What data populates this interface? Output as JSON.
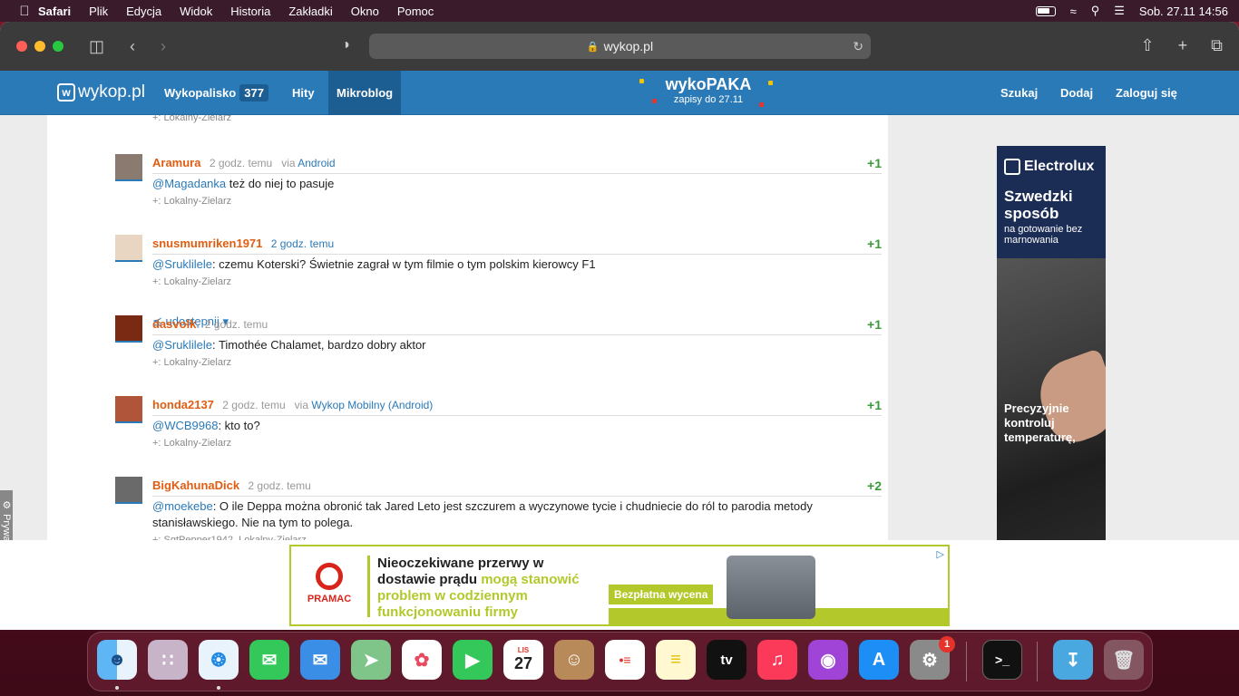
{
  "menubar": {
    "app": "Safari",
    "items": [
      "Plik",
      "Edycja",
      "Widok",
      "Historia",
      "Zakładki",
      "Okno",
      "Pomoc"
    ],
    "datetime": "Sob. 27.11  14:56"
  },
  "browser": {
    "url": "wykop.pl"
  },
  "nav": {
    "logo": "wykop.pl",
    "wykopalisko": "Wykopalisko",
    "wykopalisko_count": "377",
    "hity": "Hity",
    "mikroblog": "Mikroblog",
    "promo_title": "wykoPAKA",
    "promo_sub": "zapisy do 27.11",
    "szukaj": "Szukaj",
    "dodaj": "Dodaj",
    "zaloguj": "Zaloguj się"
  },
  "top_tags": "Lokalny-Zielarz",
  "posts": [
    {
      "author": "Aramura",
      "time": "2 godz. temu",
      "via_prefix": "via",
      "via": "Android",
      "vote": "+1",
      "mention": "@Magadanka",
      "text": " też do niej to pasuje",
      "tags": "Lokalny-Zielarz"
    },
    {
      "author": "snusmumriken1971",
      "time": "2 godz. temu",
      "via_prefix": "",
      "via": "",
      "vote": "+1",
      "mention": "@Sruklilele",
      "text": ": czemu Koterski? Świetnie zagrał w tym filmie o tym polskim kierowcy F1",
      "tags": "Lokalny-Zielarz"
    },
    {
      "author": "dasvolk",
      "time": "2 godz. temu",
      "via_prefix": "",
      "via": "",
      "vote": "+1",
      "mention": "@Sruklilele",
      "text": ": Timothée Chalamet, bardzo dobry aktor",
      "tags": "Lokalny-Zielarz"
    },
    {
      "author": "honda2137",
      "time": "2 godz. temu",
      "via_prefix": "via",
      "via": "Wykop Mobilny (Android)",
      "vote": "+1",
      "mention": "@WCB9968",
      "text": ": kto to?",
      "tags": "Lokalny-Zielarz"
    },
    {
      "author": "BigKahunaDick",
      "time": "2 godz. temu",
      "via_prefix": "",
      "via": "",
      "vote": "+2",
      "mention": "@moekebe",
      "text": ": O ile Deppa można obronić tak Jared Leto jest szczurem a wyczynowe tycie i chudniecie do ról to parodia metody stanisławskiego. Nie na tym to polega.",
      "tags": "SgtPepper1942, Lokalny-Zielarz"
    }
  ],
  "share_label": "udostępnij",
  "privacy_label": "Prywatność",
  "side_ad": {
    "brand": "Electrolux",
    "headline": "Szwedzki sposób",
    "sub": "na gotowanie bez marnowania",
    "bottom": "Precyzyjnie kontroluj temperaturę,"
  },
  "banner": {
    "brand": "PRAMAC",
    "line_black": "Nieoczekiwane przerwy w dostawie prądu",
    "line_green": " mogą stanowić problem w codziennym funkcjonowaniu firmy",
    "cta": "Bezpłatna wycena"
  },
  "dock": {
    "calendar_month": "LIS",
    "calendar_day": "27",
    "settings_badge": "1",
    "tv_label": "tv"
  },
  "colors": {
    "wykop_blue": "#2b7ab8",
    "author_orange": "#e05d12",
    "vote_green": "#3a9a3a",
    "pramac_green": "#b3c92b"
  }
}
